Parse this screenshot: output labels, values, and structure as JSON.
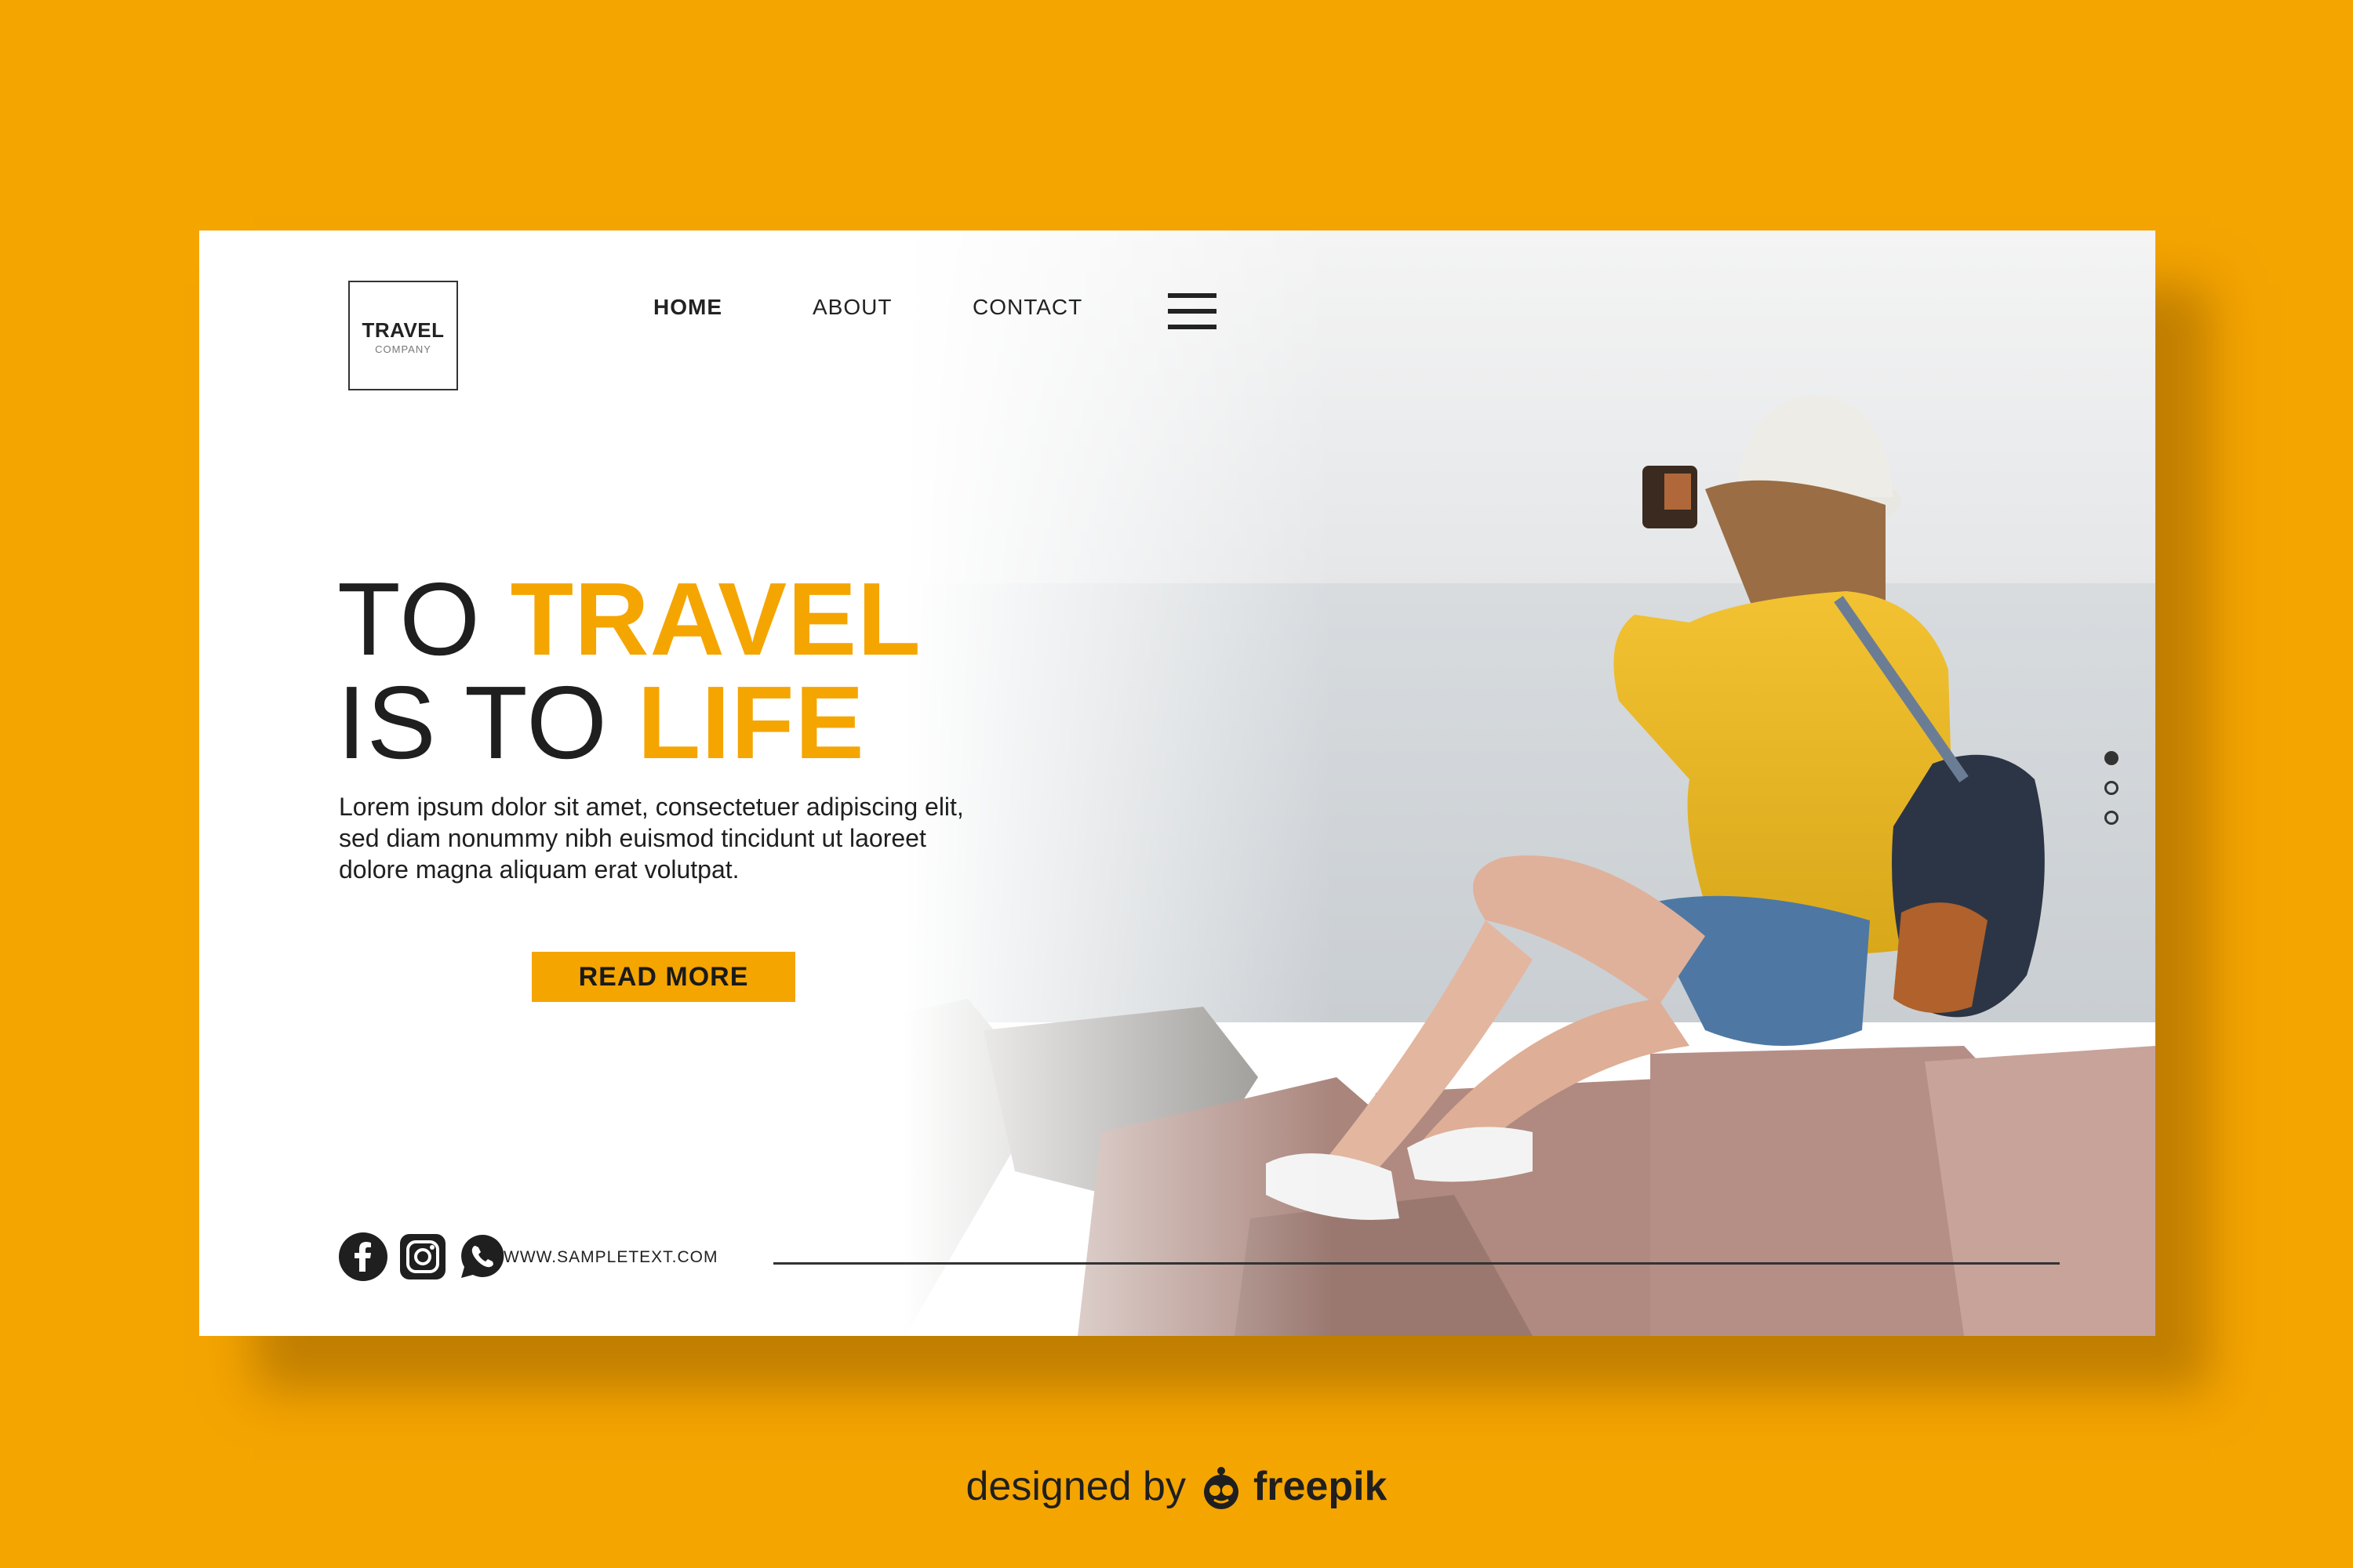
{
  "colors": {
    "accent": "#F5A500",
    "text": "#1f1f1f",
    "card": "#ffffff"
  },
  "logo": {
    "line1": "TRAVEL",
    "line2": "COMPANY"
  },
  "nav": {
    "items": [
      {
        "label": "HOME",
        "active": true
      },
      {
        "label": "ABOUT",
        "active": false
      },
      {
        "label": "CONTACT",
        "active": false
      }
    ],
    "menu_icon": "hamburger-icon"
  },
  "hero": {
    "line1_plain": "TO ",
    "line1_highlight": "TRAVEL",
    "line2_plain": "IS TO ",
    "line2_highlight": "LIFE",
    "body": "Lorem ipsum dolor sit amet, consectetuer adipiscing elit, sed diam nonummy nibh euismod tincidunt ut laoreet dolore magna aliquam erat volutpat.",
    "cta_label": "READ MORE"
  },
  "footer": {
    "social_icons": [
      "facebook-icon",
      "instagram-icon",
      "whatsapp-icon"
    ],
    "website": "WWW.SAMPLETEXT.COM"
  },
  "slider": {
    "count": 3,
    "active_index": 0
  },
  "credit": {
    "prefix": "designed by",
    "brand": "freepik"
  }
}
